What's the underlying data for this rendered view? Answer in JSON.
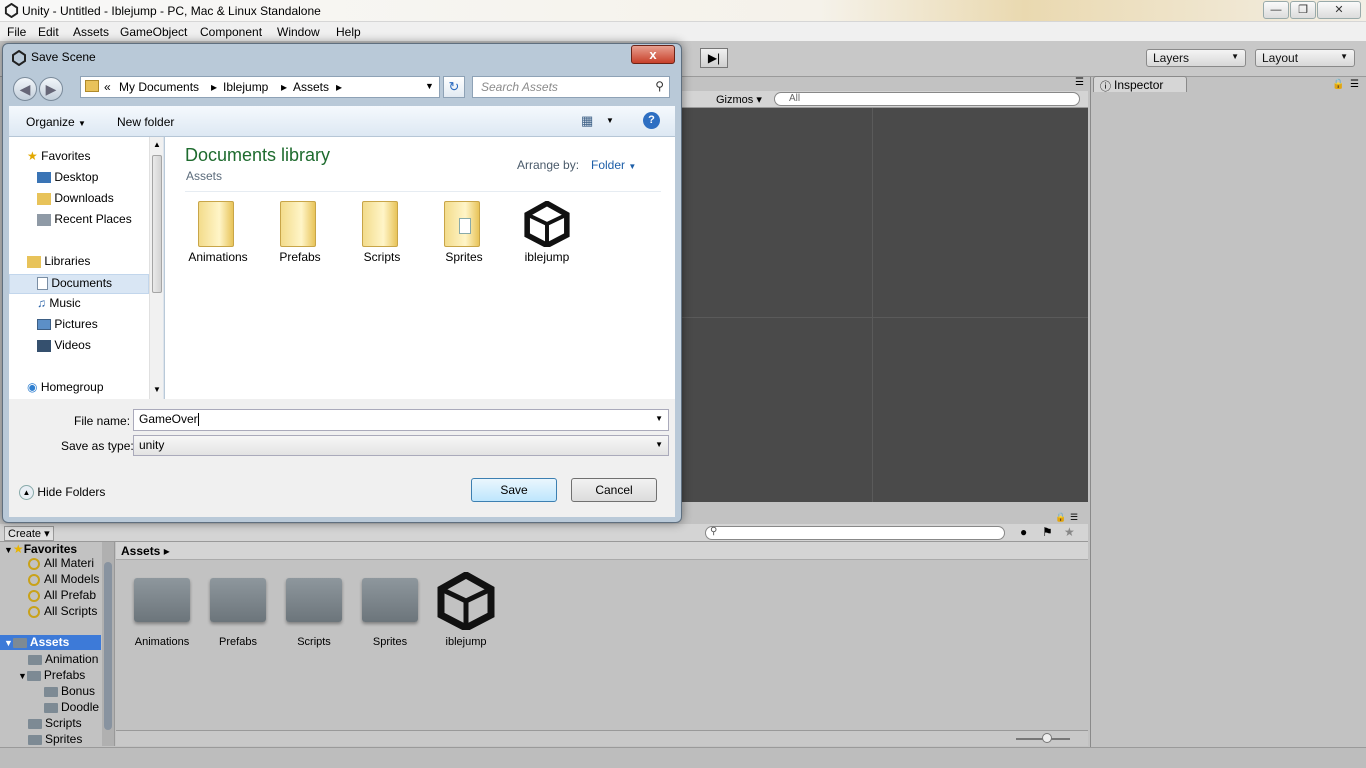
{
  "window": {
    "title": "Unity - Untitled - Iblejump - PC, Mac & Linux Standalone"
  },
  "menu": [
    "File",
    "Edit",
    "Assets",
    "GameObject",
    "Component",
    "Window",
    "Help"
  ],
  "toolbar": {
    "layers_label": "Layers",
    "layout_label": "Layout"
  },
  "scene": {
    "gizmos_label": "Gizmos",
    "search_placeholder": "All"
  },
  "inspector": {
    "tab_label": "Inspector"
  },
  "project": {
    "create_label": "Create",
    "favorites_label": "Favorites",
    "favorites": [
      "All Materi",
      "All Models",
      "All Prefab",
      "All Scripts"
    ],
    "assets_root": "Assets",
    "tree": [
      {
        "label": "Animation",
        "level": 1
      },
      {
        "label": "Prefabs",
        "level": 1
      },
      {
        "label": "Bonus",
        "level": 2
      },
      {
        "label": "Doodle",
        "level": 2
      },
      {
        "label": "Scripts",
        "level": 1
      },
      {
        "label": "Sprites",
        "level": 1
      }
    ],
    "breadcrumb": "Assets",
    "items": [
      {
        "label": "Animations",
        "type": "folder"
      },
      {
        "label": "Prefabs",
        "type": "folder"
      },
      {
        "label": "Scripts",
        "type": "folder"
      },
      {
        "label": "Sprites",
        "type": "folder"
      },
      {
        "label": "iblejump",
        "type": "unity"
      }
    ]
  },
  "dialog": {
    "title": "Save Scene",
    "close_label": "x",
    "path": [
      "My Documents",
      "Iblejump",
      "Assets"
    ],
    "path_prefix": "«",
    "search_placeholder": "Search Assets",
    "organize_label": "Organize",
    "new_folder_label": "New folder",
    "nav": {
      "favorites_label": "Favorites",
      "favorites": [
        "Desktop",
        "Downloads",
        "Recent Places"
      ],
      "libraries_label": "Libraries",
      "libraries": [
        "Documents",
        "Music",
        "Pictures",
        "Videos"
      ],
      "homegroup_label": "Homegroup",
      "selected": "Documents"
    },
    "library_title": "Documents library",
    "library_subtitle": "Assets",
    "arrange_label": "Arrange by:",
    "arrange_value": "Folder",
    "files": [
      {
        "label": "Animations",
        "type": "folder"
      },
      {
        "label": "Prefabs",
        "type": "folder"
      },
      {
        "label": "Scripts",
        "type": "folder"
      },
      {
        "label": "Sprites",
        "type": "folder-doc"
      },
      {
        "label": "iblejump",
        "type": "unity"
      }
    ],
    "file_name_label": "File name:",
    "file_name_value": "GameOver",
    "save_type_label": "Save as type:",
    "save_type_value": "unity",
    "hide_folders_label": "Hide Folders",
    "save_label": "Save",
    "cancel_label": "Cancel"
  },
  "colors": {
    "selection": "#3d7ad8",
    "library_title": "#1e6b2e",
    "scene_bg": "#4a4a4a"
  }
}
